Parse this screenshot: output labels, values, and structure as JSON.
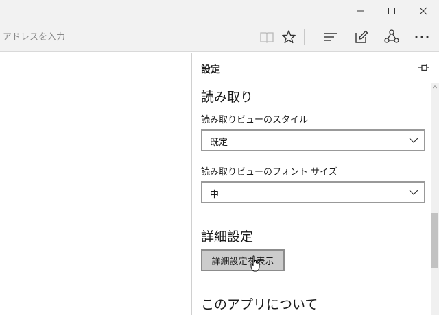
{
  "browser": {
    "address_placeholder": "アドレスを入力"
  },
  "settings": {
    "title": "設定",
    "reading": {
      "heading": "読み取り",
      "style_label": "読み取りビューのスタイル",
      "style_value": "既定",
      "font_label": "読み取りビューのフォント サイズ",
      "font_value": "中"
    },
    "advanced": {
      "heading": "詳細設定",
      "button_label": "詳細設定を表示"
    },
    "about": {
      "heading": "このアプリについて"
    }
  },
  "scroll": {
    "position": 0.72,
    "visible_fraction": 0.25
  }
}
